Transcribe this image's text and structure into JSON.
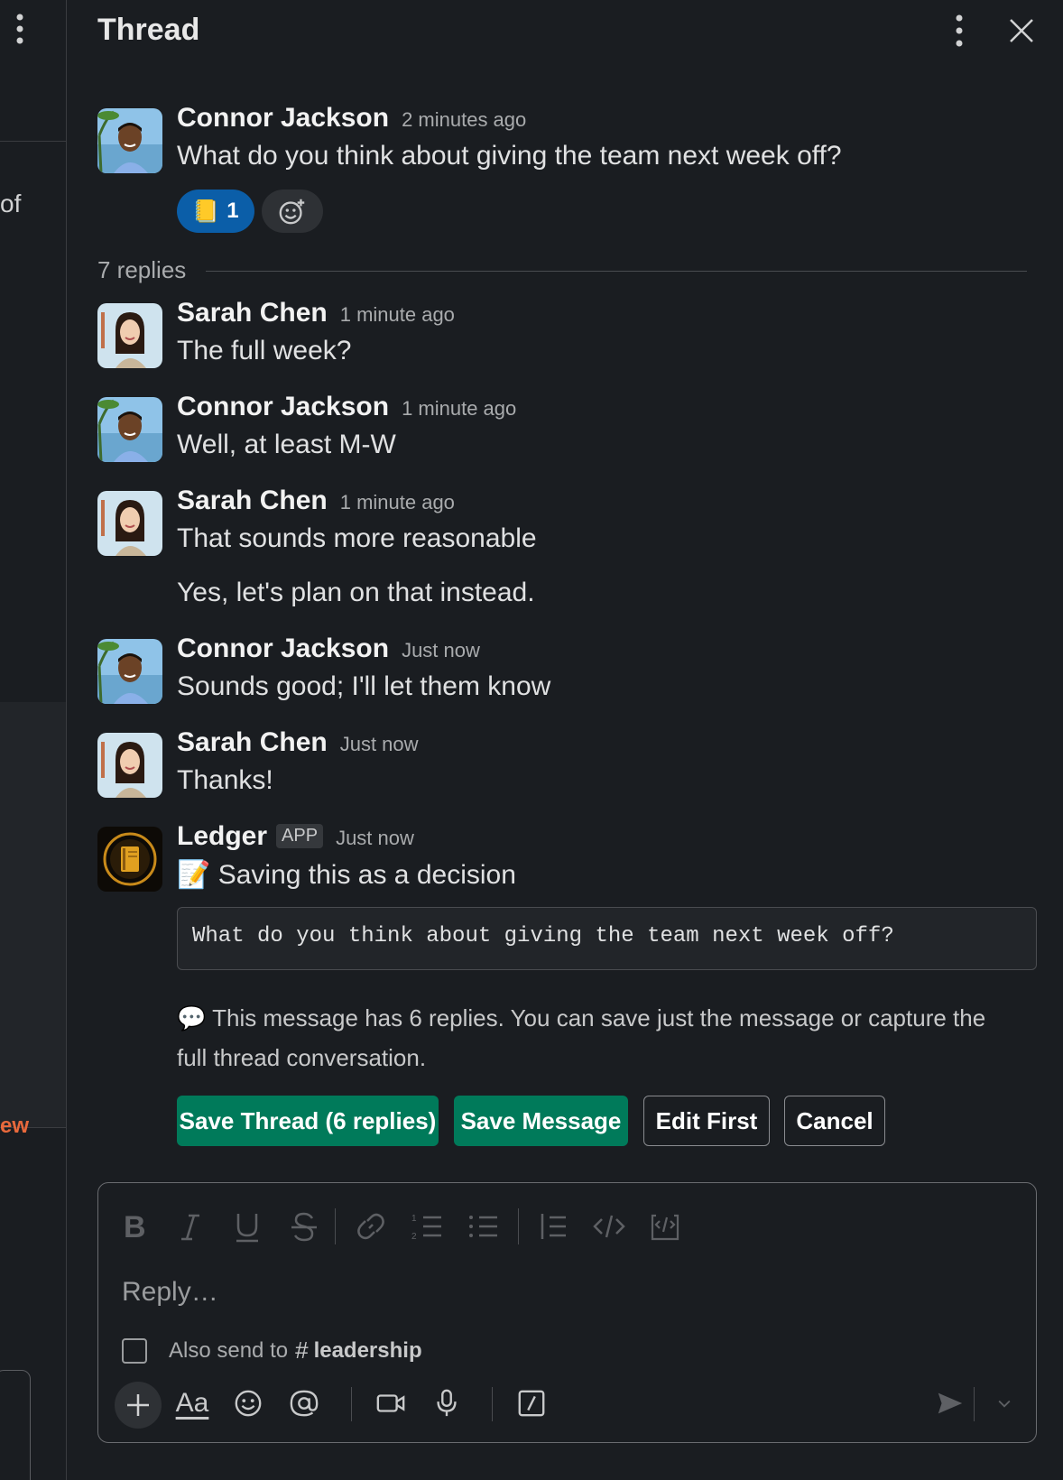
{
  "left_pane": {
    "fragment_of": "of",
    "fragment_ew": "ew"
  },
  "header": {
    "title": "Thread"
  },
  "parent_message": {
    "author": "Connor Jackson",
    "time": "2 minutes ago",
    "text": "What do you think about giving the team next week off?",
    "reaction": {
      "emoji": "📒",
      "count": "1"
    }
  },
  "replies_label": "7 replies",
  "replies": [
    {
      "author": "Sarah Chen",
      "time": "1 minute ago",
      "lines": [
        "The full week?"
      ]
    },
    {
      "author": "Connor Jackson",
      "time": "1 minute ago",
      "lines": [
        "Well, at least M-W"
      ]
    },
    {
      "author": "Sarah Chen",
      "time": "1 minute ago",
      "lines": [
        "That sounds more reasonable",
        "Yes, let's plan on that instead."
      ]
    },
    {
      "author": "Connor Jackson",
      "time": "Just now",
      "lines": [
        "Sounds good; I'll let them know"
      ]
    },
    {
      "author": "Sarah Chen",
      "time": "Just now",
      "lines": [
        "Thanks!"
      ]
    }
  ],
  "ledger": {
    "author": "Ledger",
    "badge": "APP",
    "time": "Just now",
    "heading_emoji": "📝",
    "heading": "Saving this as a decision",
    "quoted": "What do you think about giving the team next week off?",
    "info_emoji": "💬",
    "info": "This message has 6 replies. You can save just the message or capture the full thread conversation.",
    "buttons": {
      "save_thread": "Save Thread (6 replies)",
      "save_message": "Save Message",
      "edit_first": "Edit First",
      "cancel": "Cancel"
    }
  },
  "composer": {
    "placeholder": "Reply…",
    "also_send_label": "Also send to",
    "hash": "#",
    "channel": "leadership",
    "text_format_label": "Aa"
  },
  "colors": {
    "background": "#1a1d21",
    "primary_button": "#007a5a",
    "reaction_bg": "#0b5ea8",
    "accent_orange": "#e8693c"
  }
}
